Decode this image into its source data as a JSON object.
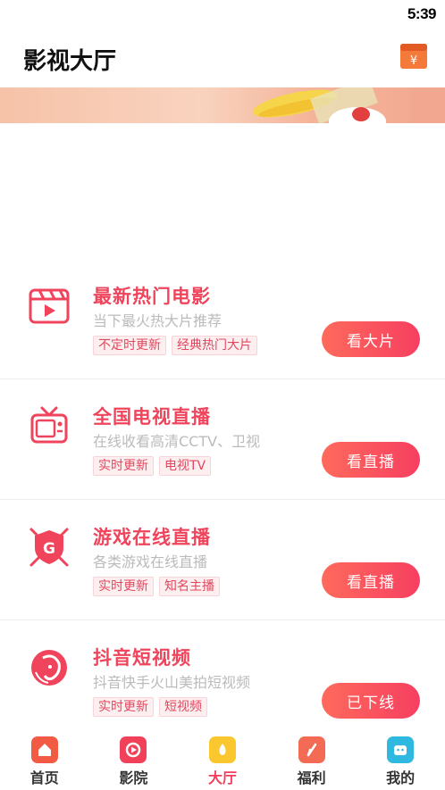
{
  "status": {
    "time": "5:39"
  },
  "header": {
    "title": "影视大厅",
    "wallet_icon": "wallet-icon",
    "wallet_symbol": "¥"
  },
  "colors": {
    "accent": "#f0445c",
    "button_start": "#fe6a5c",
    "button_end": "#f73f61",
    "tag_bg": "#fdeef0"
  },
  "items": [
    {
      "title": "最新热门电影",
      "subtitle": "当下最火热大片推荐",
      "tags": [
        "不定时更新",
        "经典热门大片"
      ],
      "button": "看大片",
      "icon": "film-icon"
    },
    {
      "title": "全国电视直播",
      "subtitle": "在线收看高清CCTV、卫视",
      "tags": [
        "实时更新",
        "电视TV"
      ],
      "button": "看直播",
      "icon": "tv-icon"
    },
    {
      "title": "游戏在线直播",
      "subtitle": "各类游戏在线直播",
      "tags": [
        "实时更新",
        "知名主播"
      ],
      "button": "看直播",
      "icon": "game-shield-icon"
    },
    {
      "title": "抖音短视频",
      "subtitle": "抖音快手火山美拍短视频",
      "tags": [
        "实时更新",
        "短视频"
      ],
      "button": "已下线",
      "icon": "face-icon"
    }
  ],
  "tabs": [
    {
      "label": "首页",
      "icon": "home-icon"
    },
    {
      "label": "影院",
      "icon": "cinema-icon"
    },
    {
      "label": "大厅",
      "icon": "hall-icon"
    },
    {
      "label": "福利",
      "icon": "gift-icon"
    },
    {
      "label": "我的",
      "icon": "profile-icon"
    }
  ]
}
